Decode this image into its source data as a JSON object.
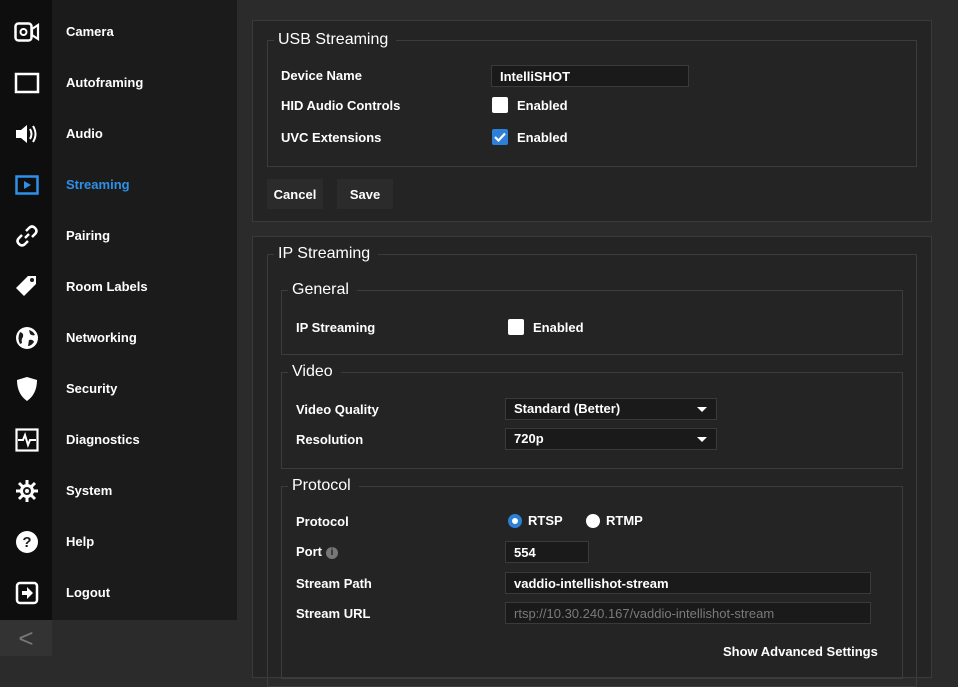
{
  "sidebar": {
    "items": [
      {
        "name": "camera",
        "label": "Camera",
        "icon": "camera-icon"
      },
      {
        "name": "autoframing",
        "label": "Autoframing",
        "icon": "autoframing-icon"
      },
      {
        "name": "audio",
        "label": "Audio",
        "icon": "speaker-icon"
      },
      {
        "name": "streaming",
        "label": "Streaming",
        "icon": "play-icon",
        "active": true
      },
      {
        "name": "pairing",
        "label": "Pairing",
        "icon": "link-icon"
      },
      {
        "name": "room-labels",
        "label": "Room Labels",
        "icon": "tag-icon"
      },
      {
        "name": "networking",
        "label": "Networking",
        "icon": "globe-icon"
      },
      {
        "name": "security",
        "label": "Security",
        "icon": "shield-icon"
      },
      {
        "name": "diagnostics",
        "label": "Diagnostics",
        "icon": "pulse-icon"
      },
      {
        "name": "system",
        "label": "System",
        "icon": "gear-icon"
      },
      {
        "name": "help",
        "label": "Help",
        "icon": "question-icon"
      },
      {
        "name": "logout",
        "label": "Logout",
        "icon": "logout-icon"
      }
    ],
    "collapse_glyph": "<"
  },
  "usb": {
    "title": "USB Streaming",
    "device_name_label": "Device Name",
    "device_name_value": "IntelliSHOT",
    "hid_label": "HID Audio Controls",
    "hid_check_label": "Enabled",
    "hid_checked": false,
    "uvc_label": "UVC Extensions",
    "uvc_check_label": "Enabled",
    "uvc_checked": true,
    "cancel_label": "Cancel",
    "save_label": "Save"
  },
  "ip": {
    "title": "IP Streaming",
    "general": {
      "title": "General",
      "ip_streaming_label": "IP Streaming",
      "ip_streaming_check_label": "Enabled",
      "checked": false
    },
    "video": {
      "title": "Video",
      "quality_label": "Video Quality",
      "quality_value": "Standard (Better)",
      "resolution_label": "Resolution",
      "resolution_value": "720p"
    },
    "protocol": {
      "title": "Protocol",
      "protocol_label": "Protocol",
      "rtsp_label": "RTSP",
      "rtmp_label": "RTMP",
      "selected": "RTSP",
      "port_label": "Port",
      "port_value": "554",
      "stream_path_label": "Stream Path",
      "stream_path_value": "vaddio-intellishot-stream",
      "stream_url_label": "Stream URL",
      "stream_url_value": "rtsp://10.30.240.167/vaddio-intellishot-stream",
      "advanced_label": "Show Advanced Settings"
    }
  },
  "colors": {
    "accent": "#2e90e8",
    "checkbox_checked": "#2e7fd8",
    "sidebar_bg": "#1b1b1b",
    "panel_bg": "#242424"
  }
}
